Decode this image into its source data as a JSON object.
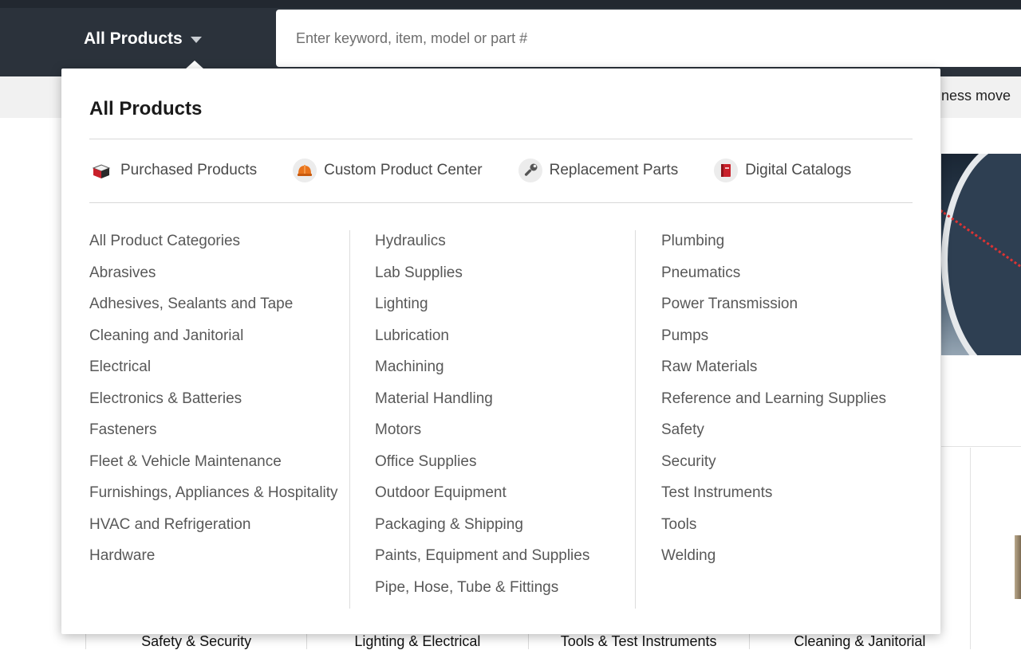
{
  "header": {
    "products_label": "All Products",
    "search_placeholder": "Enter keyword, item, model or part #"
  },
  "background": {
    "promo_text": "ness move",
    "bottom_categories": [
      "Safety & Security",
      "Lighting & Electrical",
      "Tools & Test Instruments",
      "Cleaning & Janitorial"
    ]
  },
  "dropdown": {
    "title": "All Products",
    "quick_links": [
      {
        "label": "Purchased Products",
        "icon": "purchased-box-icon"
      },
      {
        "label": "Custom Product Center",
        "icon": "hard-hat-icon"
      },
      {
        "label": "Replacement Parts",
        "icon": "wrench-icon"
      },
      {
        "label": "Digital Catalogs",
        "icon": "catalog-book-icon"
      }
    ],
    "columns": [
      [
        "All Product Categories",
        "Abrasives",
        "Adhesives, Sealants and Tape",
        "Cleaning and Janitorial",
        "Electrical",
        "Electronics & Batteries",
        "Fasteners",
        "Fleet & Vehicle Maintenance",
        "Furnishings, Appliances & Hospitality",
        "HVAC and Refrigeration",
        "Hardware"
      ],
      [
        "Hydraulics",
        "Lab Supplies",
        "Lighting",
        "Lubrication",
        "Machining",
        "Material Handling",
        "Motors",
        "Office Supplies",
        "Outdoor Equipment",
        "Packaging & Shipping",
        "Paints, Equipment and Supplies",
        "Pipe, Hose, Tube & Fittings"
      ],
      [
        "Plumbing",
        "Pneumatics",
        "Power Transmission",
        "Pumps",
        "Raw Materials",
        "Reference and Learning Supplies",
        "Safety",
        "Security",
        "Test Instruments",
        "Tools",
        "Welding"
      ]
    ]
  }
}
